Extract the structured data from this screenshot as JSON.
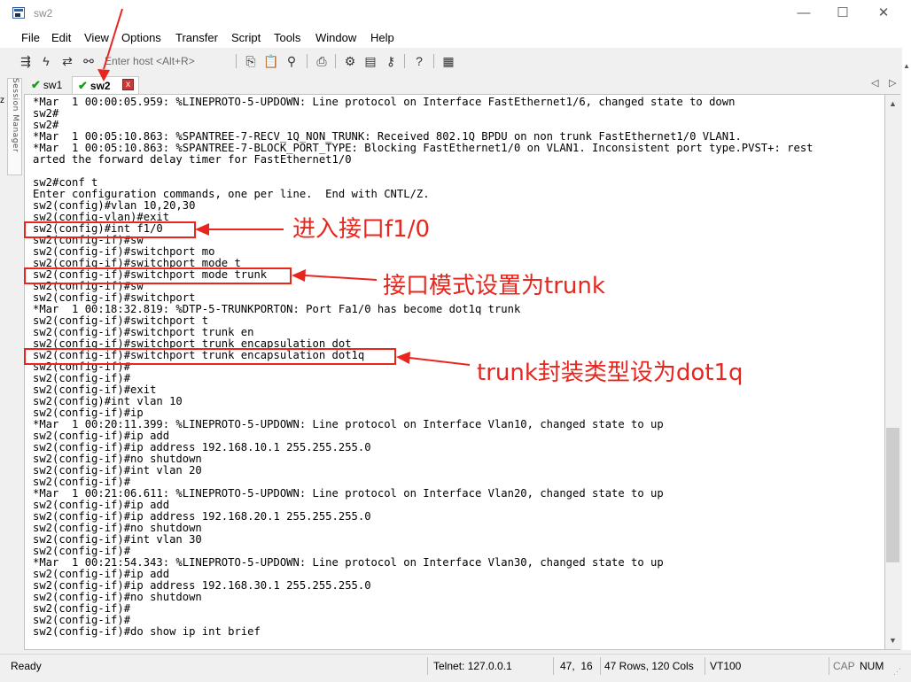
{
  "window": {
    "title": "sw2",
    "minimize_glyph": "—",
    "maximize_glyph": "☐",
    "close_glyph": "✕"
  },
  "menu": [
    "File",
    "Edit",
    "View",
    "Options",
    "Transfer",
    "Script",
    "Tools",
    "Window",
    "Help"
  ],
  "toolbar": {
    "host_placeholder": "Enter host <Alt+R>",
    "icons": [
      "connect-icon",
      "quick-connect-icon",
      "reconnect-icon",
      "disconnect-icon",
      "copy-icon",
      "paste-icon",
      "find-icon",
      "print-icon",
      "settings-icon",
      "keymap-icon",
      "sftp-icon",
      "help-icon",
      "script-icon"
    ]
  },
  "session_manager": {
    "label": "Session Manager"
  },
  "tabs": [
    {
      "label": "sw1",
      "connected": true,
      "active": false
    },
    {
      "label": "sw2",
      "connected": true,
      "active": true
    }
  ],
  "tab_close_glyph": "x",
  "terminal": {
    "lines": [
      "*Mar  1 00:00:05.959: %LINEPROTO-5-UPDOWN: Line protocol on Interface FastEthernet1/6, changed state to down",
      "sw2#",
      "sw2#",
      "*Mar  1 00:05:10.863: %SPANTREE-7-RECV_1Q_NON_TRUNK: Received 802.1Q BPDU on non trunk FastEthernet1/0 VLAN1.",
      "*Mar  1 00:05:10.863: %SPANTREE-7-BLOCK_PORT_TYPE: Blocking FastEthernet1/0 on VLAN1. Inconsistent port type.PVST+: rest",
      "arted the forward delay timer for FastEthernet1/0",
      "",
      "sw2#conf t",
      "Enter configuration commands, one per line.  End with CNTL/Z.",
      "sw2(config)#vlan 10,20,30",
      "sw2(config-vlan)#exit",
      "sw2(config)#int f1/0",
      "sw2(config-if)#sw",
      "sw2(config-if)#switchport mo",
      "sw2(config-if)#switchport mode t",
      "sw2(config-if)#switchport mode trunk",
      "sw2(config-if)#sw",
      "sw2(config-if)#switchport",
      "*Mar  1 00:18:32.819: %DTP-5-TRUNKPORTON: Port Fa1/0 has become dot1q trunk",
      "sw2(config-if)#switchport t",
      "sw2(config-if)#switchport trunk en",
      "sw2(config-if)#switchport trunk encapsulation dot",
      "sw2(config-if)#switchport trunk encapsulation dot1q",
      "sw2(config-if)#",
      "sw2(config-if)#",
      "sw2(config-if)#exit",
      "sw2(config)#int vlan 10",
      "sw2(config-if)#ip",
      "*Mar  1 00:20:11.399: %LINEPROTO-5-UPDOWN: Line protocol on Interface Vlan10, changed state to up",
      "sw2(config-if)#ip add",
      "sw2(config-if)#ip address 192.168.10.1 255.255.255.0",
      "sw2(config-if)#no shutdown",
      "sw2(config-if)#int vlan 20",
      "sw2(config-if)#",
      "*Mar  1 00:21:06.611: %LINEPROTO-5-UPDOWN: Line protocol on Interface Vlan20, changed state to up",
      "sw2(config-if)#ip add",
      "sw2(config-if)#ip address 192.168.20.1 255.255.255.0",
      "sw2(config-if)#no shutdown",
      "sw2(config-if)#int vlan 30",
      "sw2(config-if)#",
      "*Mar  1 00:21:54.343: %LINEPROTO-5-UPDOWN: Line protocol on Interface Vlan30, changed state to up",
      "sw2(config-if)#ip add",
      "sw2(config-if)#ip address 192.168.30.1 255.255.255.0",
      "sw2(config-if)#no shutdown",
      "sw2(config-if)#",
      "sw2(config-if)#",
      "sw2(config-if)#do show ip int brief"
    ]
  },
  "annotations": [
    {
      "text": "进入接口f1/0"
    },
    {
      "text": "接口模式设置为trunk"
    },
    {
      "text": "trunk封装类型设为dot1q"
    }
  ],
  "annotation_color": "#e8261e",
  "status": {
    "ready": "Ready",
    "telnet": "Telnet: 127.0.0.1",
    "cursor": "47,  16",
    "size": "47 Rows, 120 Cols",
    "term": "VT100",
    "caps": "CAP",
    "num": "NUM"
  }
}
